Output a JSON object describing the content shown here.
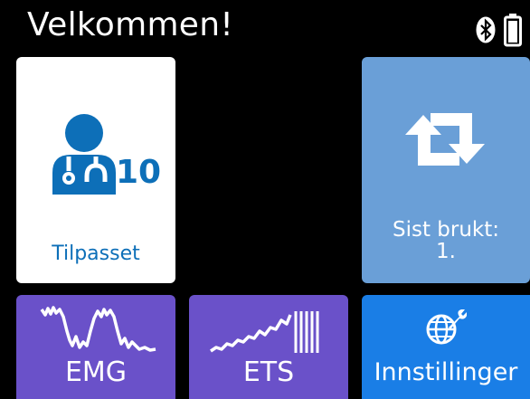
{
  "header": {
    "title": "Velkommen!",
    "icons": {
      "bluetooth": "bluetooth-icon",
      "battery": "battery-icon"
    }
  },
  "tiles": {
    "custom": {
      "label": "Tilpasset",
      "count": "10",
      "icon": "doctor-icon"
    },
    "last_used": {
      "label": "Sist brukt:",
      "value": "1.",
      "icon": "repeat-icon"
    },
    "emg": {
      "label": "EMG",
      "icon": "emg-wave-icon"
    },
    "ets": {
      "label": "ETS",
      "icon": "ets-wave-icon"
    },
    "settings": {
      "label": "Innstillinger",
      "icon": "globe-wrench-icon"
    }
  },
  "colors": {
    "background": "#000000",
    "custom_tile": "#ffffff",
    "accent_blue": "#0d6fb8",
    "last_used_tile": "#6a9fd7",
    "purple_tile": "#6a51c9",
    "settings_tile": "#1a7ee6"
  }
}
